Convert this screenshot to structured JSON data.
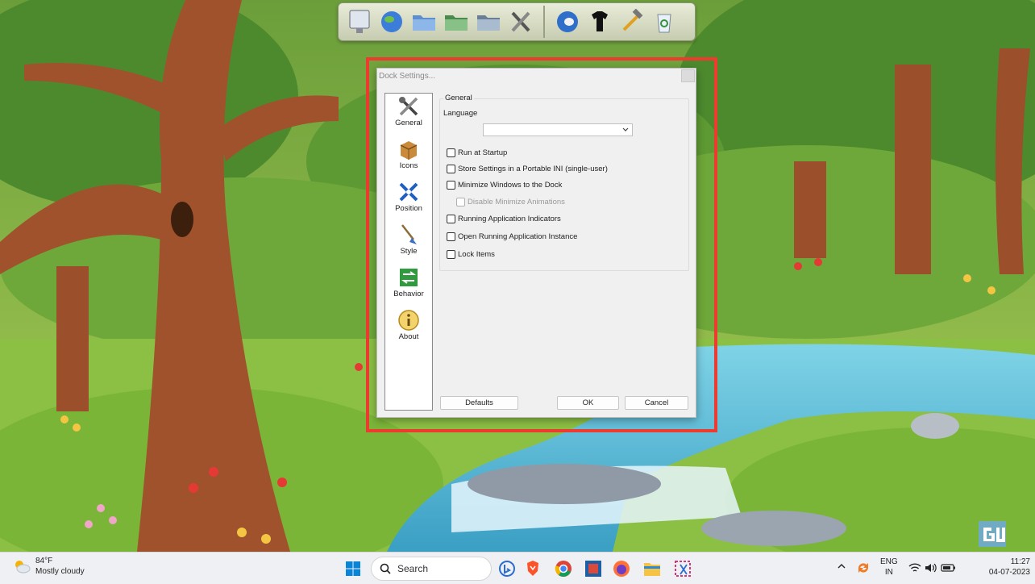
{
  "dialog": {
    "title": "Dock Settings...",
    "nav": [
      {
        "label": "General",
        "icon": "tools-icon"
      },
      {
        "label": "Icons",
        "icon": "box-icon"
      },
      {
        "label": "Position",
        "icon": "arrows-icon"
      },
      {
        "label": "Style",
        "icon": "brush-icon"
      },
      {
        "label": "Behavior",
        "icon": "swap-icon"
      },
      {
        "label": "About",
        "icon": "info-icon"
      }
    ],
    "group_title": "General",
    "language_label": "Language",
    "language_value": "",
    "checkboxes": [
      {
        "label": "Run at Startup",
        "checked": false,
        "disabled": false
      },
      {
        "label": "Store Settings in a Portable INI (single-user)",
        "checked": false,
        "disabled": false
      },
      {
        "label": "Minimize Windows to the Dock",
        "checked": false,
        "disabled": false
      },
      {
        "label": "Disable Minimize Animations",
        "checked": false,
        "disabled": true
      },
      {
        "label": "Running Application Indicators",
        "checked": false,
        "disabled": false
      },
      {
        "label": "Open Running Application Instance",
        "checked": false,
        "disabled": false
      },
      {
        "label": "Lock Items",
        "checked": false,
        "disabled": false
      }
    ],
    "buttons": {
      "defaults": "Defaults",
      "ok": "OK",
      "cancel": "Cancel"
    }
  },
  "taskbar": {
    "weather_temp": "84°F",
    "weather_desc": "Mostly cloudy",
    "search_placeholder": "Search",
    "lang_top": "ENG",
    "lang_bottom": "IN",
    "time": "11:27",
    "date": "04-07-2023"
  },
  "colors": {
    "highlight": "#ee3b2f",
    "accent": "#0067c0"
  }
}
